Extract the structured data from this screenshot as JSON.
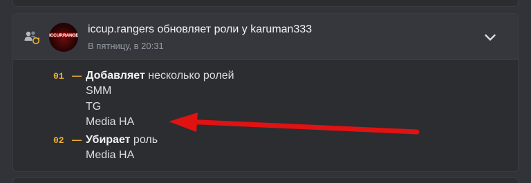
{
  "audit_entry": {
    "actor": "iccup.rangers",
    "action_text": "обновляет роли у",
    "target": "karuman333",
    "timestamp": "В пятницу, в 20:31",
    "avatar_text": "ICCUP.RANGERS",
    "changes": [
      {
        "index": "01",
        "dash": "—",
        "action": "Добавляет",
        "description": "несколько ролей",
        "roles": [
          "SMM",
          "TG",
          "Media HA"
        ]
      },
      {
        "index": "02",
        "dash": "—",
        "action": "Убирает",
        "description": "роль",
        "roles": [
          "Media HA"
        ]
      }
    ]
  },
  "icons": {
    "left": "members-role-update-icon",
    "expand": "chevron-down-icon"
  },
  "colors": {
    "background": "#313338",
    "card": "#2b2d31",
    "header": "#35373c",
    "index_accent": "#f0b132",
    "annotation_arrow": "#e01212"
  }
}
